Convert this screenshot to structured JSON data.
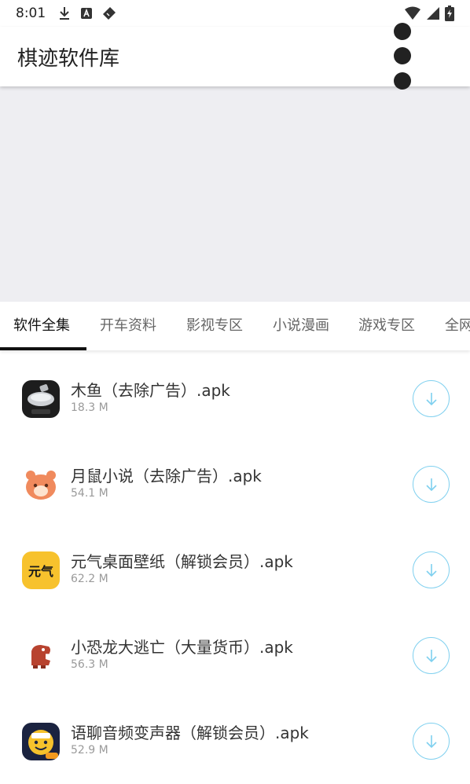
{
  "status_bar": {
    "time": "8:01",
    "left_icons": [
      "download-icon",
      "a-box-icon",
      "tag-icon"
    ],
    "right_icons": [
      "wifi-icon",
      "signal-icon",
      "battery-charging-icon"
    ]
  },
  "app_bar": {
    "title": "棋迹软件库",
    "overflow_icon": "more-vert-icon"
  },
  "tabs": [
    {
      "label": "软件全集",
      "active": true
    },
    {
      "label": "开车资料",
      "active": false
    },
    {
      "label": "影视专区",
      "active": false
    },
    {
      "label": "小说漫画",
      "active": false
    },
    {
      "label": "游戏专区",
      "active": false
    },
    {
      "label": "全网",
      "active": false
    }
  ],
  "apps": [
    {
      "name": "木鱼（去除广告）.apk",
      "size": "18.3 M",
      "icon": "muyu-app-icon"
    },
    {
      "name": "月鼠小说（去除广告）.apk",
      "size": "54.1 M",
      "icon": "hamster-app-icon"
    },
    {
      "name": "元气桌面壁纸（解锁会员）.apk",
      "size": "62.2 M",
      "icon": "yuanqi-app-icon",
      "icon_text": "元气"
    },
    {
      "name": "小恐龙大逃亡（大量货币）.apk",
      "size": "56.3 M",
      "icon": "dinosaur-app-icon"
    },
    {
      "name": "语聊音频变声器（解锁会员）.apk",
      "size": "52.9 M",
      "icon": "voice-changer-app-icon"
    }
  ],
  "colors": {
    "accent": "#7fd0ef",
    "banner_bg": "#eeeef2",
    "tab_indicator": "#111111",
    "yuanqi_bg": "#f7c22d",
    "hamster_bg": "#f08a5d"
  }
}
